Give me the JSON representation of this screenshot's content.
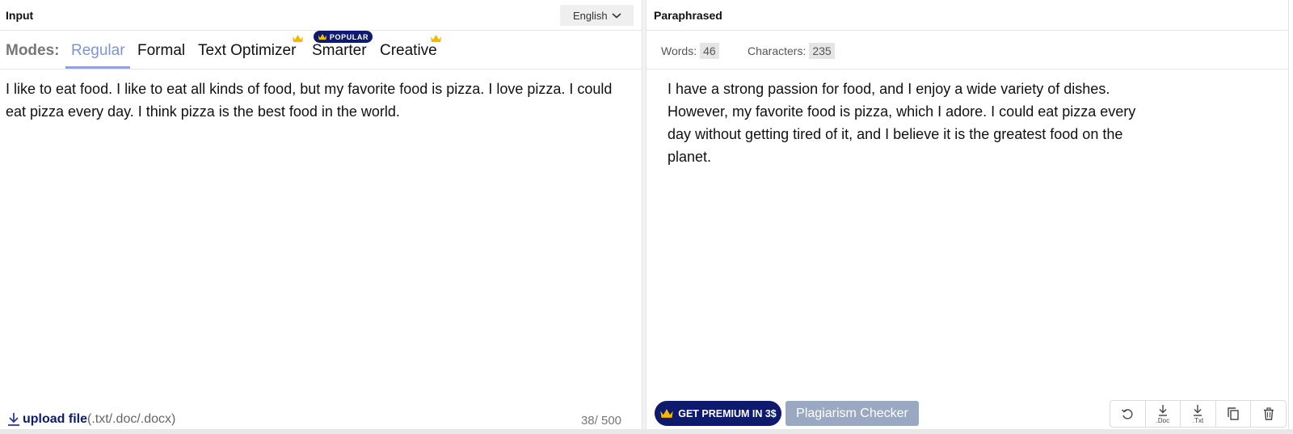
{
  "input_panel": {
    "title": "Input",
    "language": "English",
    "modes_label": "Modes:",
    "modes": [
      {
        "label": "Regular",
        "active": true,
        "premium": false
      },
      {
        "label": "Formal",
        "active": false,
        "premium": false
      },
      {
        "label": "Text Optimizer",
        "active": false,
        "premium": true
      },
      {
        "label": "Smarter",
        "active": false,
        "premium": false
      },
      {
        "label": "Creative",
        "active": false,
        "premium": true
      }
    ],
    "popular_badge": "POPULAR",
    "text": "I like to eat food. I like to eat all kinds of food, but my favorite food is pizza. I love pizza. I could eat pizza every day. I think pizza is the best food in the world.",
    "upload_label": "upload file",
    "upload_ext": "(.txt/.doc/.docx)",
    "counter": "38/ 500"
  },
  "output_panel": {
    "title": "Paraphrased",
    "words_label": "Words:",
    "words_value": "46",
    "chars_label": "Characters:",
    "chars_value": "235",
    "text": "I have a strong passion for food, and I enjoy a wide variety of dishes. However, my favorite food is pizza, which I adore. I could eat pizza every day without getting tired of it, and I believe it is the greatest food on the planet.",
    "premium_button": "GET PREMIUM IN 3$",
    "plagiarism_button": "Plagiarism Checker",
    "tools": [
      {
        "icon": "undo-icon",
        "caption": ""
      },
      {
        "icon": "download-icon",
        "caption": ".Doc"
      },
      {
        "icon": "download-icon",
        "caption": ".Txt"
      },
      {
        "icon": "copy-icon",
        "caption": ""
      },
      {
        "icon": "trash-icon",
        "caption": ""
      }
    ]
  },
  "colors": {
    "accent": "#0d1a6e",
    "active_tab": "#7e93d6",
    "crown": "#f5b800",
    "plagiarism_button": "#9aa8c2"
  }
}
